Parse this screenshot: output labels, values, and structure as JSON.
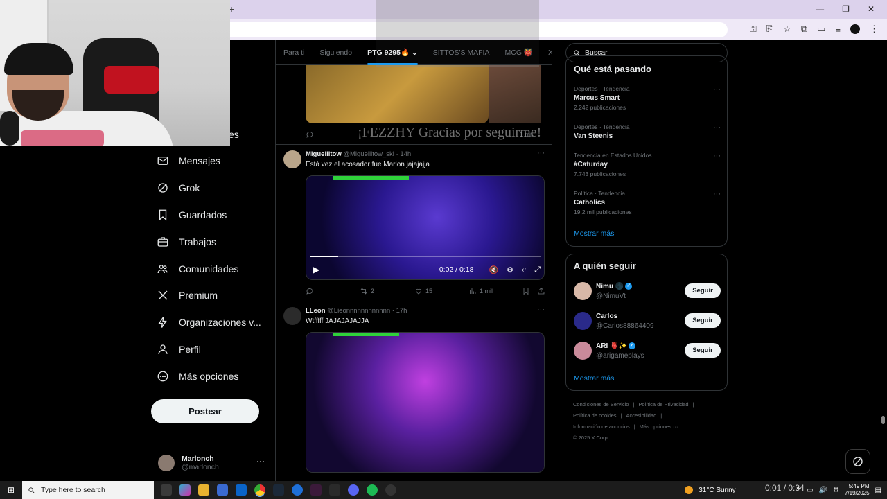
{
  "browser": {
    "new_tab_icon": "plus-icon",
    "window_controls": [
      "minimize-icon",
      "restore-icon",
      "close-icon"
    ],
    "toolbar_icons": [
      "key-icon",
      "install-icon",
      "star-icon",
      "extensions-icon",
      "sidebar-icon",
      "media-icon"
    ]
  },
  "nav": {
    "partial_item": "es",
    "items": [
      {
        "label": "Mensajes",
        "icon": "mail-icon"
      },
      {
        "label": "Grok",
        "icon": "grok-icon"
      },
      {
        "label": "Guardados",
        "icon": "bookmark-icon"
      },
      {
        "label": "Trabajos",
        "icon": "briefcase-icon"
      },
      {
        "label": "Comunidades",
        "icon": "people-icon"
      },
      {
        "label": "Premium",
        "icon": "x-logo-icon"
      },
      {
        "label": "Organizaciones v...",
        "icon": "lightning-icon"
      },
      {
        "label": "Perfil",
        "icon": "person-icon"
      },
      {
        "label": "Más opciones",
        "icon": "more-circle-icon"
      }
    ],
    "post_label": "Postear",
    "account": {
      "name": "Marlonch",
      "handle": "@marlonch",
      "more": "···"
    }
  },
  "tabs": [
    {
      "label": "Para ti",
      "active": false
    },
    {
      "label": "Siguiendo",
      "active": false
    },
    {
      "label": "PTG 9295🔥 ⌄",
      "active": true
    },
    {
      "label": "SITTOS'S MAFIA",
      "active": false
    },
    {
      "label": "MCG 👹",
      "active": false
    },
    {
      "label": "X R",
      "active": false
    }
  ],
  "overlay": {
    "text": "¡FEZZHY Gracias por seguirme!"
  },
  "feed": {
    "top_actions": {
      "views": "1 mil"
    },
    "tweets": [
      {
        "name": "Migueliitow",
        "handle": "@Migueliitow_skl · 14h",
        "text": "Está vez el acosador fue Marlon jajajajja",
        "video": {
          "time": "0:02 / 0:18",
          "progress": 0.12
        },
        "replies": "",
        "reposts": "2",
        "likes": "15",
        "views": "1 mil"
      },
      {
        "name": "LLeon",
        "handle": "@Lieonnnnnnnnnnnn · 17h",
        "text": "Wtfffff JAJAJAJAJJA"
      }
    ]
  },
  "search": {
    "placeholder": "Buscar"
  },
  "trending": {
    "title": "Qué está pasando",
    "items": [
      {
        "category": "Deportes · Tendencia",
        "title": "Marcus Smart",
        "count": "2.242 publicaciones"
      },
      {
        "category": "Deportes · Tendencia",
        "title": "Van Steenis",
        "count": ""
      },
      {
        "category": "Tendencia en Estados Unidos",
        "title": "#Caturday",
        "count": "7.743 publicaciones"
      },
      {
        "category": "Política · Tendencia",
        "title": "Catholics",
        "count": "19,2 mil publicaciones"
      }
    ],
    "more": "Mostrar más"
  },
  "who_to_follow": {
    "title": "A quién seguir",
    "items": [
      {
        "name": "Nimu 🌑",
        "handle": "@NimuVt",
        "button": "Seguir",
        "verified": true
      },
      {
        "name": "Carlos",
        "handle": "@Carlos88864409",
        "button": "Seguir",
        "verified": false
      },
      {
        "name": "ARI 🫀✨",
        "handle": "@arigameplays",
        "button": "Seguir",
        "verified": true
      }
    ],
    "more": "Mostrar más"
  },
  "footer": {
    "links": [
      "Condiciones de Servicio",
      "|",
      "Política de Privacidad",
      "|",
      "Política de cookies",
      "|",
      "Accesibilidad",
      "|",
      "Información de anuncios",
      "|",
      "Más opciones ···"
    ],
    "copyright": "© 2025 X Corp."
  },
  "taskbar": {
    "search_placeholder": "Type here to search",
    "weather": "31°C  Sunny",
    "timer": "0:01 / 0:34",
    "time": "5:49 PM",
    "date": "7/19/2025"
  },
  "colors": {
    "accent": "#1d9bf0",
    "background": "#000000",
    "border": "#2f3336",
    "muted": "#71767b"
  }
}
